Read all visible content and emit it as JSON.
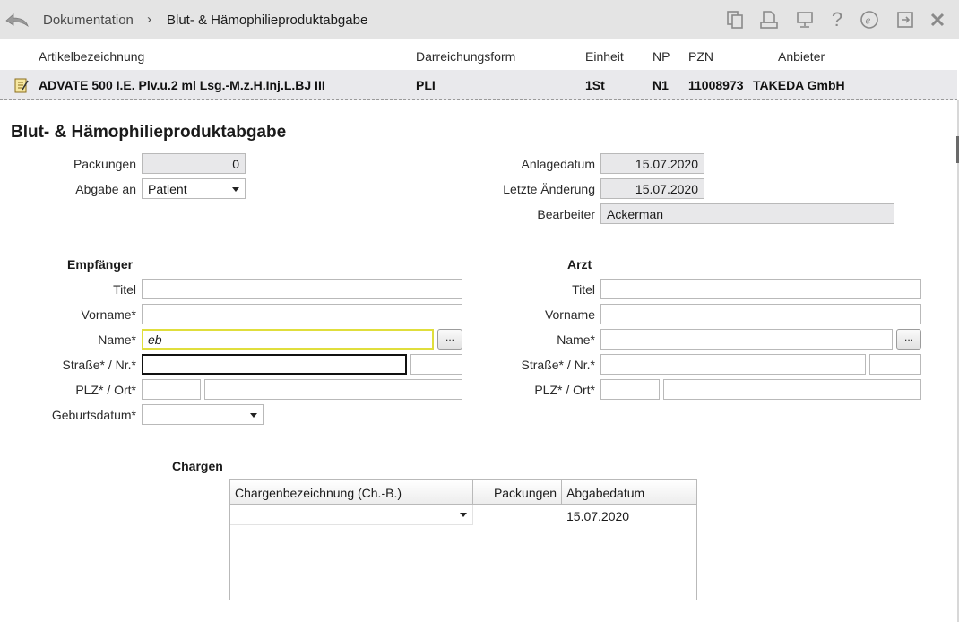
{
  "breadcrumb": {
    "parent": "Dokumentation",
    "separator": "›",
    "current": "Blut- & Hämophilieproduktabgabe"
  },
  "toolbar_icons": [
    "copy-icon",
    "print-preview-icon",
    "monitor-icon",
    "help-icon",
    "e-icon",
    "exit-window-icon",
    "close-icon"
  ],
  "article": {
    "headers": {
      "name": "Artikelbezeichnung",
      "form": "Darreichungsform",
      "unit": "Einheit",
      "np": "NP",
      "pzn": "PZN",
      "supplier": "Anbieter"
    },
    "row": {
      "name": "ADVATE 500 I.E. Plv.u.2 ml Lsg.-M.z.H.Inj.L.BJ III",
      "form": "PLI",
      "unit": "1St",
      "np": "N1",
      "pzn": "11008973",
      "supplier": "TAKEDA GmbH"
    }
  },
  "form": {
    "title": "Blut- & Hämophilieproduktabgabe",
    "packages_label": "Packungen",
    "packages_value": "0",
    "dispense_to_label": "Abgabe an",
    "dispense_to_value": "Patient",
    "created_label": "Anlagedatum",
    "created_value": "15.07.2020",
    "changed_label": "Letzte Änderung",
    "changed_value": "15.07.2020",
    "editor_label": "Bearbeiter",
    "editor_value": "Ackerman"
  },
  "recipient": {
    "title": "Empfänger",
    "title_label": "Titel",
    "title_value": "",
    "firstname_label": "Vorname*",
    "firstname_value": "",
    "name_label": "Name*",
    "name_value": "eb",
    "street_label": "Straße* / Nr.*",
    "street_value": "",
    "number_value": "",
    "zip_label": "PLZ* / Ort*",
    "zip_value": "",
    "city_value": "",
    "birthdate_label": "Geburtsdatum*",
    "birthdate_value": "",
    "lookup_label": "..."
  },
  "doctor": {
    "title": "Arzt",
    "title_label": "Titel",
    "title_value": "",
    "firstname_label": "Vorname",
    "firstname_value": "",
    "name_label": "Name*",
    "name_value": "",
    "street_label": "Straße* / Nr.*",
    "street_value": "",
    "number_value": "",
    "zip_label": "PLZ* / Ort*",
    "zip_value": "",
    "city_value": "",
    "lookup_label": "..."
  },
  "batches": {
    "title": "Chargen",
    "columns": [
      "Chargenbezeichnung (Ch.-B.)",
      "Packungen",
      "Abgabedatum"
    ],
    "rows": [
      {
        "batch": "",
        "packages": "",
        "date": "15.07.2020"
      }
    ]
  }
}
